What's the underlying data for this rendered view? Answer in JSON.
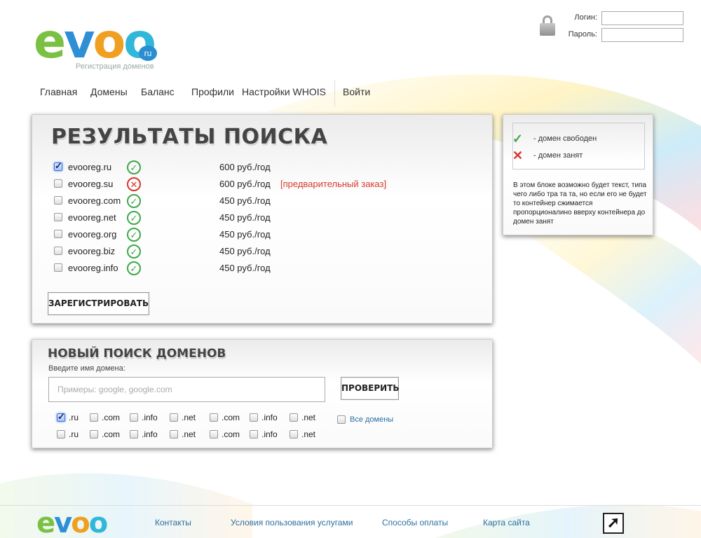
{
  "logo": {
    "letters": [
      "e",
      "v",
      "o",
      "o"
    ],
    "ru": "ru",
    "subtitle": "Регистрация доменов"
  },
  "login": {
    "login_label": "Логин:",
    "password_label": "Пароль:",
    "login_value": "",
    "password_value": ""
  },
  "nav": [
    {
      "label": "Главная"
    },
    {
      "label": "Домены"
    },
    {
      "label": "Баланс"
    },
    {
      "label": "Профили"
    },
    {
      "label": "Настройки WHOIS"
    },
    {
      "label": "Войти"
    }
  ],
  "results": {
    "title": "РЕЗУЛЬТАТЫ ПОИСКА",
    "rows": [
      {
        "name": "evooreg.ru",
        "checked": true,
        "status": "free",
        "price": "600 руб./год",
        "note": ""
      },
      {
        "name": "evooreg.su",
        "checked": false,
        "status": "busy",
        "price": "600 руб./год",
        "note": "[предварительный заказ]"
      },
      {
        "name": "evooreg.com",
        "checked": false,
        "status": "free",
        "price": "450 руб./год",
        "note": ""
      },
      {
        "name": "evooreg.net",
        "checked": false,
        "status": "free",
        "price": "450 руб./год",
        "note": ""
      },
      {
        "name": "evooreg.org",
        "checked": false,
        "status": "free",
        "price": "450 руб./год",
        "note": ""
      },
      {
        "name": "evooreg.biz",
        "checked": false,
        "status": "free",
        "price": "450 руб./год",
        "note": ""
      },
      {
        "name": "evooreg.info",
        "checked": false,
        "status": "free",
        "price": "450 руб./год",
        "note": ""
      }
    ],
    "register_label": "ЗАРЕГИСТРИРОВАТЬ"
  },
  "new_search": {
    "title": "НОВЫЙ ПОИСК ДОМЕНОВ",
    "label": "Введите имя домена:",
    "placeholder": "Примеры: google, google.com",
    "value": "",
    "check_label": "ПРОВЕРИТЬ",
    "zones_row1": [
      {
        "name": ".ru",
        "checked": true
      },
      {
        "name": ".com",
        "checked": false
      },
      {
        "name": ".info",
        "checked": false
      },
      {
        "name": ".net",
        "checked": false
      },
      {
        "name": ".com",
        "checked": false
      },
      {
        "name": ".info",
        "checked": false
      },
      {
        "name": ".net",
        "checked": false
      }
    ],
    "zones_row2": [
      {
        "name": ".ru",
        "checked": false
      },
      {
        "name": ".com",
        "checked": false
      },
      {
        "name": ".info",
        "checked": false
      },
      {
        "name": ".net",
        "checked": false
      },
      {
        "name": ".com",
        "checked": false
      },
      {
        "name": ".info",
        "checked": false
      },
      {
        "name": ".net",
        "checked": false
      }
    ],
    "all_domains_label": "Все домены",
    "all_domains_checked": false
  },
  "legend": {
    "free_symbol": "✓",
    "free_label": "- домен свободен",
    "busy_symbol": "✕",
    "busy_label": "- домен занят",
    "text": "В этом блоке возможно будет текст, типа чего либо тра та та, но если его не будет то контейнер сжимается пропорционалино вверху контейнера до домен занят"
  },
  "footer": {
    "logo_letters": [
      "e",
      "v",
      "o",
      "o"
    ],
    "links": [
      "Контакты",
      "Условия пользования услугами",
      "Способы оплаты",
      "Карта сайта"
    ],
    "arrow_symbol": "➚"
  },
  "icons": {
    "free": "✓",
    "busy": "✕"
  },
  "colors": {
    "free": "#3ea84a",
    "busy": "#d9342a",
    "link": "#2a6fa0",
    "note": "#d63a2a"
  }
}
